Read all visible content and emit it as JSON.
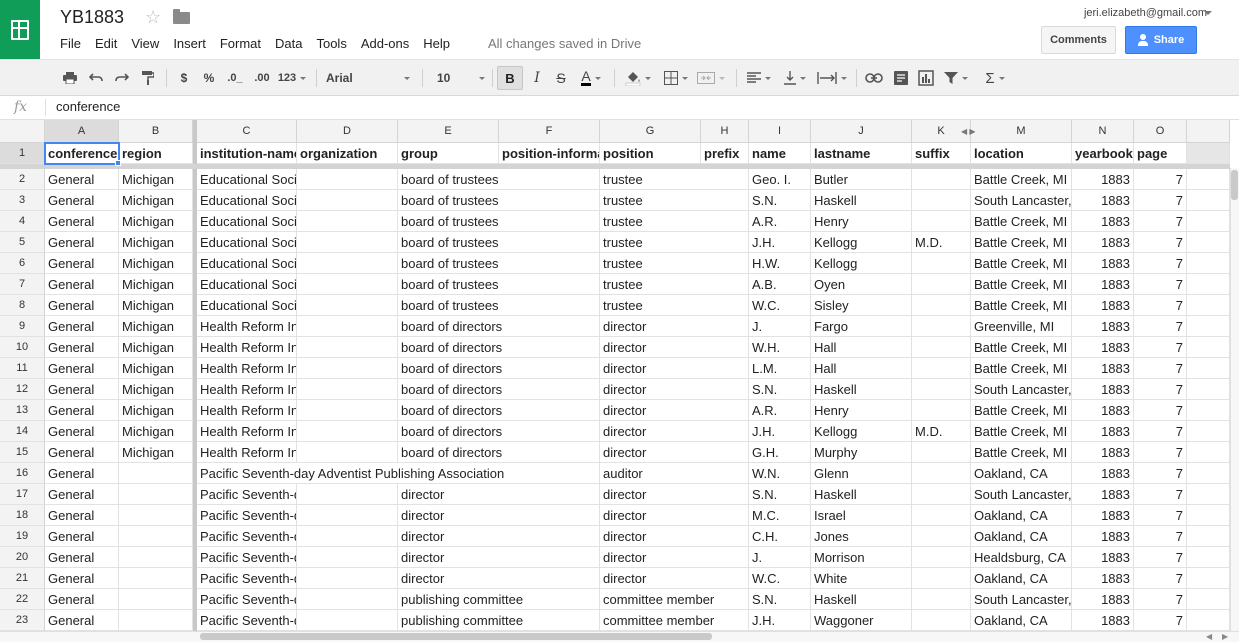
{
  "app": {
    "doc_title": "YB1883",
    "menu": [
      "File",
      "Edit",
      "View",
      "Insert",
      "Format",
      "Data",
      "Tools",
      "Add-ons",
      "Help"
    ],
    "save_status": "All changes saved in Drive",
    "account_email": "jeri.elizabeth@gmail.com",
    "comments_label": "Comments",
    "share_label": "Share",
    "accent_color": "#0f9d58",
    "share_color": "#4d90fe"
  },
  "toolbar": {
    "currency": "$",
    "percent": "%",
    "decrease_decimals": ".0_",
    "increase_decimals": ".00",
    "number_format": "123",
    "font": "Arial",
    "font_size": "10",
    "bold": "B",
    "italic": "I",
    "strikethrough": "S",
    "text_color": "A",
    "functions": "Σ"
  },
  "formula_bar": {
    "fx_label": "fx",
    "value": "conference"
  },
  "grid": {
    "column_letters": [
      "A",
      "B",
      "C",
      "D",
      "E",
      "F",
      "G",
      "H",
      "I",
      "J",
      "K",
      "M",
      "N",
      "O"
    ],
    "selected_cell": "A1",
    "row_numbers": [
      "1",
      "2",
      "3",
      "4",
      "5",
      "6",
      "7",
      "8",
      "9",
      "10",
      "11",
      "12",
      "13",
      "14",
      "15",
      "16",
      "17",
      "18",
      "19",
      "20",
      "21",
      "22",
      "23"
    ],
    "header_row": [
      "conference",
      "region",
      "institution-name",
      "organization",
      "group",
      "position-information",
      "position",
      "prefix",
      "name",
      "lastname",
      "suffix",
      "location",
      "yearbook",
      "page"
    ],
    "rows": [
      [
        "General",
        "Michigan",
        "Educational Society",
        "",
        "board of trustees",
        "",
        "trustee",
        "",
        "Geo. I.",
        "Butler",
        "",
        "Battle Creek, MI",
        "1883",
        "7"
      ],
      [
        "General",
        "Michigan",
        "Educational Society",
        "",
        "board of trustees",
        "",
        "trustee",
        "",
        "S.N.",
        "Haskell",
        "",
        "South Lancaster, MA",
        "1883",
        "7"
      ],
      [
        "General",
        "Michigan",
        "Educational Society",
        "",
        "board of trustees",
        "",
        "trustee",
        "",
        "A.R.",
        "Henry",
        "",
        "Battle Creek, MI",
        "1883",
        "7"
      ],
      [
        "General",
        "Michigan",
        "Educational Society",
        "",
        "board of trustees",
        "",
        "trustee",
        "",
        "J.H.",
        "Kellogg",
        "M.D.",
        "Battle Creek, MI",
        "1883",
        "7"
      ],
      [
        "General",
        "Michigan",
        "Educational Society",
        "",
        "board of trustees",
        "",
        "trustee",
        "",
        "H.W.",
        "Kellogg",
        "",
        "Battle Creek, MI",
        "1883",
        "7"
      ],
      [
        "General",
        "Michigan",
        "Educational Society",
        "",
        "board of trustees",
        "",
        "trustee",
        "",
        "A.B.",
        "Oyen",
        "",
        "Battle Creek, MI",
        "1883",
        "7"
      ],
      [
        "General",
        "Michigan",
        "Educational Society",
        "",
        "board of trustees",
        "",
        "trustee",
        "",
        "W.C.",
        "Sisley",
        "",
        "Battle Creek, MI",
        "1883",
        "7"
      ],
      [
        "General",
        "Michigan",
        "Health Reform Institute",
        "",
        "board of directors",
        "",
        "director",
        "",
        "J.",
        "Fargo",
        "",
        "Greenville, MI",
        "1883",
        "7"
      ],
      [
        "General",
        "Michigan",
        "Health Reform Institute",
        "",
        "board of directors",
        "",
        "director",
        "",
        "W.H.",
        "Hall",
        "",
        "Battle Creek, MI",
        "1883",
        "7"
      ],
      [
        "General",
        "Michigan",
        "Health Reform Institute",
        "",
        "board of directors",
        "",
        "director",
        "",
        "L.M.",
        "Hall",
        "",
        "Battle Creek, MI",
        "1883",
        "7"
      ],
      [
        "General",
        "Michigan",
        "Health Reform Institute",
        "",
        "board of directors",
        "",
        "director",
        "",
        "S.N.",
        "Haskell",
        "",
        "South Lancaster, MA",
        "1883",
        "7"
      ],
      [
        "General",
        "Michigan",
        "Health Reform Institute",
        "",
        "board of directors",
        "",
        "director",
        "",
        "A.R.",
        "Henry",
        "",
        "Battle Creek, MI",
        "1883",
        "7"
      ],
      [
        "General",
        "Michigan",
        "Health Reform Institute",
        "",
        "board of directors",
        "",
        "director",
        "",
        "J.H.",
        "Kellogg",
        "M.D.",
        "Battle Creek, MI",
        "1883",
        "7"
      ],
      [
        "General",
        "Michigan",
        "Health Reform Institute",
        "",
        "board of directors",
        "",
        "director",
        "",
        "G.H.",
        "Murphy",
        "",
        "Battle Creek, MI",
        "1883",
        "7"
      ],
      [
        "General",
        "",
        "Pacific Seventh-day Adventist Publishing Association",
        "",
        "",
        "",
        "auditor",
        "",
        "W.N.",
        "Glenn",
        "",
        "Oakland, CA",
        "1883",
        "7"
      ],
      [
        "General",
        "",
        "Pacific Seventh-day Adventist Publishing Association",
        "",
        "director",
        "",
        "director",
        "",
        "S.N.",
        "Haskell",
        "",
        "South Lancaster, MA",
        "1883",
        "7"
      ],
      [
        "General",
        "",
        "Pacific Seventh-day Adventist Publishing Association",
        "",
        "director",
        "",
        "director",
        "",
        "M.C.",
        "Israel",
        "",
        "Oakland, CA",
        "1883",
        "7"
      ],
      [
        "General",
        "",
        "Pacific Seventh-day Adventist Publishing Association",
        "",
        "director",
        "",
        "director",
        "",
        "C.H.",
        "Jones",
        "",
        "Oakland, CA",
        "1883",
        "7"
      ],
      [
        "General",
        "",
        "Pacific Seventh-day Adventist Publishing Association",
        "",
        "director",
        "",
        "director",
        "",
        "J.",
        "Morrison",
        "",
        "Healdsburg, CA",
        "1883",
        "7"
      ],
      [
        "General",
        "",
        "Pacific Seventh-day Adventist Publishing Association",
        "",
        "director",
        "",
        "director",
        "",
        "W.C.",
        "White",
        "",
        "Oakland, CA",
        "1883",
        "7"
      ],
      [
        "General",
        "",
        "Pacific Seventh-day Adventist Publishing Association",
        "",
        "publishing committee",
        "",
        "committee member",
        "",
        "S.N.",
        "Haskell",
        "",
        "South Lancaster, MA",
        "1883",
        "7"
      ],
      [
        "General",
        "",
        "Pacific Seventh-day Adventist Publishing Association",
        "",
        "publishing committee",
        "",
        "committee member",
        "",
        "J.H.",
        "Waggoner",
        "",
        "Oakland, CA",
        "1883",
        "7"
      ]
    ]
  }
}
